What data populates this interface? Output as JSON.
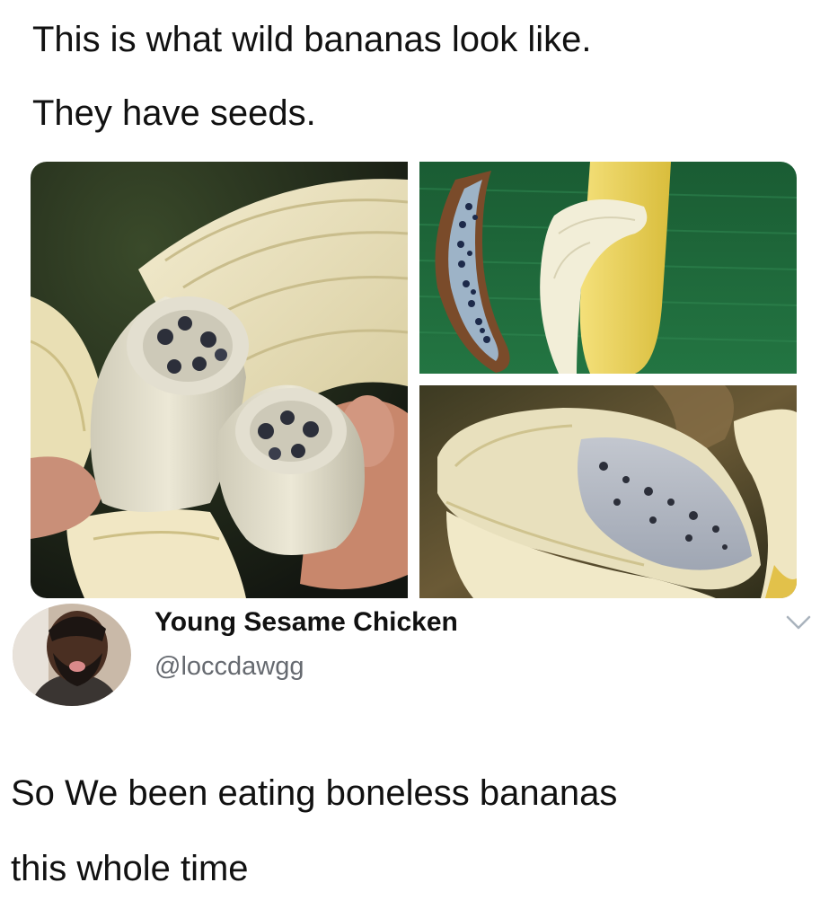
{
  "meme_caption": {
    "line1": "This is what wild bananas look like.",
    "line2": "They have seeds."
  },
  "photos": [
    {
      "icon": "seeded-banana-cross-section-photo"
    },
    {
      "icon": "split-banana-on-leaf-photo"
    },
    {
      "icon": "halved-seeded-banana-photo"
    }
  ],
  "tweet": {
    "avatar_icon": "user-avatar-photo",
    "display_name": "Young Sesame Chicken",
    "handle": "@loccdawgg",
    "menu_icon": "chevron-down-icon",
    "text_line1": "So We been eating boneless bananas",
    "text_line2": "this whole time"
  },
  "colors": {
    "text": "#111111",
    "handle": "#666a70",
    "chevron": "#aab3bd",
    "leaf_green": "#1f6b3a",
    "banana_yellow": "#e8cf52",
    "banana_flesh": "#efe9cf",
    "seed_dark": "#2c2f3a"
  }
}
